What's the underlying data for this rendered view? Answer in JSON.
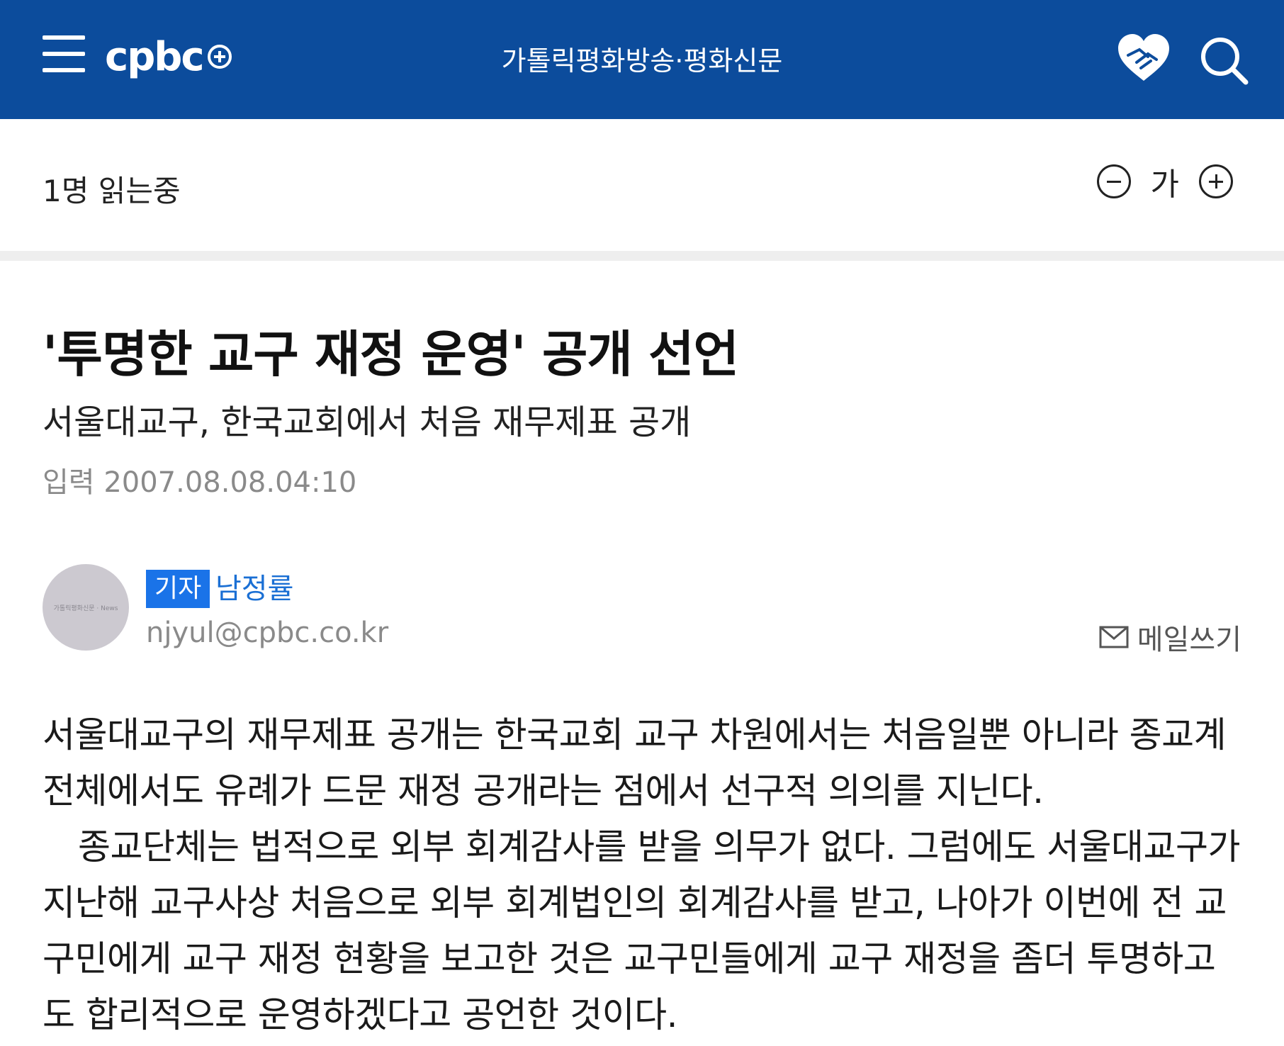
{
  "header": {
    "logo_text": "cpbc",
    "site_name": "가톨릭평화방송·평화신문",
    "icons": {
      "menu": "hamburger-icon",
      "donate": "heart-hands-icon",
      "search": "search-icon"
    }
  },
  "reading_bar": {
    "readers": "1명 읽는중",
    "font_label": "가"
  },
  "article": {
    "headline": "'투명한 교구 재정 운영' 공개 선언",
    "subheadline": "서울대교구, 한국교회에서 처음 재무제표 공개",
    "date_label": "입력",
    "date": "2007.08.08.04:10",
    "paragraphs": [
      "서울대교구의 재무제표 공개는 한국교회 교구 차원에서는 처음일뿐 아니라 종교계 전체에서도 유례가 드문 재정 공개라는 점에서 선구적 의의를 지닌다.",
      "종교단체는 법적으로 외부 회계감사를 받을 의무가 없다. 그럼에도 서울대교구가 지난해 교구사상 처음으로 외부 회계법인의 회계감사를 받고, 나아가 이번에 전 교구민에게 교구 재정 현황을 보고한 것은 교구민들에게 교구 재정을 좀더 투명하고도 합리적으로 운영하겠다고 공언한 것이다."
    ]
  },
  "reporter": {
    "avatar_text": "가톨릭평화신문 · News",
    "role": "기자",
    "name": "남정률",
    "email": "njyul@cpbc.co.kr",
    "mail_label": "메일쓰기"
  },
  "colors": {
    "brand": "#0c4c9c",
    "badge": "#1a73e8",
    "link": "#1a6fd4"
  }
}
